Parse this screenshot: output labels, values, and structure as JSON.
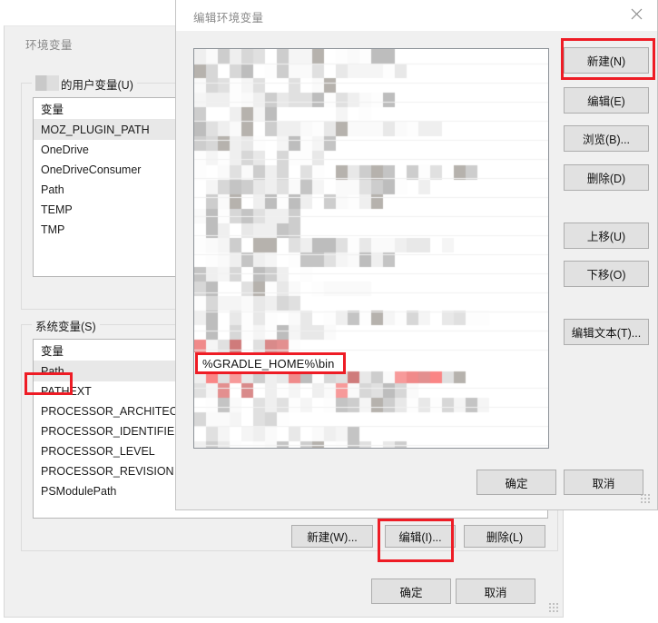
{
  "background_window": {
    "title": "环境变量",
    "user_vars_group": {
      "legend_censored_prefix": "▨",
      "legend": "的用户变量(U)",
      "column_header": "变量",
      "rows": [
        {
          "name": "MOZ_PLUGIN_PATH",
          "selected": true
        },
        {
          "name": "OneDrive",
          "selected": false
        },
        {
          "name": "OneDriveConsumer",
          "selected": false
        },
        {
          "name": "Path",
          "selected": false
        },
        {
          "name": "TEMP",
          "selected": false
        },
        {
          "name": "TMP",
          "selected": false
        }
      ]
    },
    "system_vars_group": {
      "legend": "系统变量(S)",
      "column_header": "变量",
      "rows": [
        {
          "name": "Path",
          "selected": true,
          "highlighted": true
        },
        {
          "name": "PATHEXT",
          "selected": false,
          "highlighted": false
        },
        {
          "name": "PROCESSOR_ARCHITECT...",
          "selected": false,
          "highlighted": false
        },
        {
          "name": "PROCESSOR_IDENTIFIER",
          "selected": false,
          "highlighted": false
        },
        {
          "name": "PROCESSOR_LEVEL",
          "selected": false,
          "highlighted": false
        },
        {
          "name": "PROCESSOR_REVISION",
          "selected": false,
          "highlighted": false
        },
        {
          "name": "PSModulePath",
          "selected": false,
          "highlighted": false
        }
      ]
    },
    "system_buttons": {
      "new": "新建(W)...",
      "edit": "编辑(I)...",
      "delete": "删除(L)"
    },
    "footer_buttons": {
      "ok": "确定",
      "cancel": "取消"
    }
  },
  "dialog": {
    "title": "编辑环境变量",
    "close_label": "✕",
    "list": {
      "censored": true,
      "highlighted_entry": "%GRADLE_HOME%\\bin"
    },
    "side_buttons": [
      {
        "label": "新建(N)",
        "name": "new",
        "highlighted": true
      },
      {
        "label": "编辑(E)",
        "name": "edit",
        "highlighted": false
      },
      {
        "label": "浏览(B)...",
        "name": "browse",
        "highlighted": false
      },
      {
        "label": "删除(D)",
        "name": "delete",
        "highlighted": false
      },
      {
        "label": "上移(U)",
        "name": "move-up",
        "highlighted": false
      },
      {
        "label": "下移(O)",
        "name": "move-down",
        "highlighted": false
      },
      {
        "label": "编辑文本(T)...",
        "name": "edit-text",
        "highlighted": false
      }
    ],
    "footer_buttons": {
      "ok": "确定",
      "cancel": "取消"
    }
  },
  "annotations": {
    "color": "#ee1c25",
    "boxes": [
      "new-button-dialog",
      "gradle-home-bin-entry",
      "system-path-row",
      "edit-system-variable-button"
    ]
  }
}
